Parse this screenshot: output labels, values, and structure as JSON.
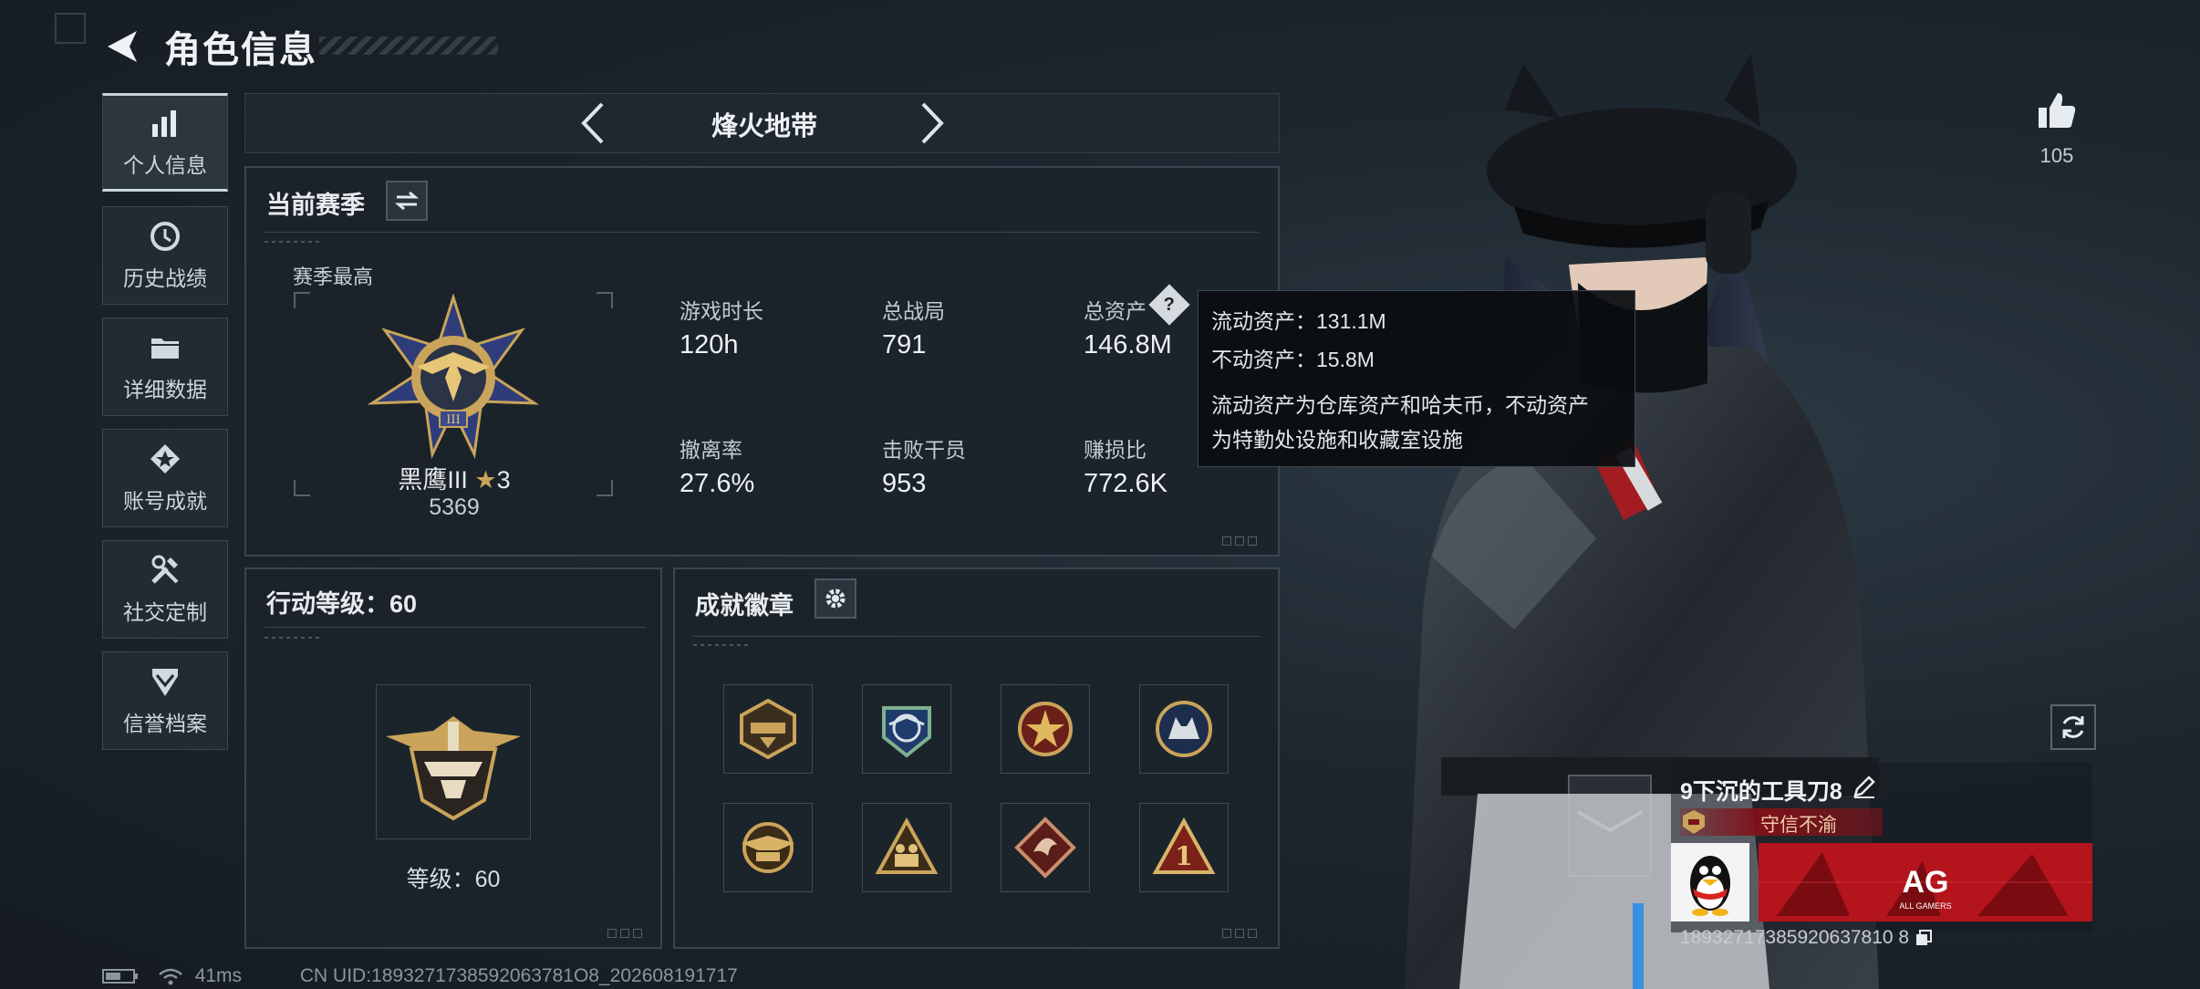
{
  "header": {
    "title": "角色信息"
  },
  "sidebar": {
    "items": [
      {
        "label": "个人信息",
        "icon": "bar-chart-icon",
        "active": true
      },
      {
        "label": "历史战绩",
        "icon": "history-clock-icon",
        "active": false
      },
      {
        "label": "详细数据",
        "icon": "folder-icon",
        "active": false
      },
      {
        "label": "账号成就",
        "icon": "achievement-medal-icon",
        "active": false
      },
      {
        "label": "社交定制",
        "icon": "tools-icon",
        "active": false
      },
      {
        "label": "信誉档案",
        "icon": "shield-chevron-icon",
        "active": false
      }
    ]
  },
  "mode": {
    "name": "烽火地带"
  },
  "season": {
    "title": "当前赛季",
    "best_label": "赛季最高",
    "rank_name": "黑鹰III",
    "rank_stars": "3",
    "rank_score": "5369",
    "stats": [
      {
        "label": "游戏时长",
        "value": "120h"
      },
      {
        "label": "总战局",
        "value": "791"
      },
      {
        "label": "总资产",
        "value": "146.8M"
      },
      {
        "label": "撤离率",
        "value": "27.6%"
      },
      {
        "label": "击败干员",
        "value": "953"
      },
      {
        "label": "赚损比",
        "value": "772.6K"
      }
    ]
  },
  "tooltip": {
    "liquid": "流动资产：131.1M",
    "fixed": "不动资产：15.8M",
    "desc_line1": "流动资产为仓库资产和哈夫币，不动资产",
    "desc_line2": "为特勤处设施和收藏室设施"
  },
  "level": {
    "title": "行动等级：60",
    "text": "等级：60"
  },
  "achievements": {
    "title": "成就徽章",
    "badges": [
      "emblem-badge-icon",
      "eagle-globe-badge-icon",
      "star-wreath-badge-icon",
      "wolf-round-badge-icon",
      "eagle-wing-badge-icon",
      "soldiers-triangle-badge-icon",
      "dragon-diamond-badge-icon",
      "number-one-triangle-badge-icon"
    ]
  },
  "status": {
    "ping": "41ms",
    "uid": "CN UID:1893271738592063781O8_202608191717"
  },
  "social": {
    "likes": "105"
  },
  "player": {
    "name": "9下沉的工具刀8",
    "title": "守信不渝",
    "uid": "18932717385920637810 8",
    "team_logo": "AG",
    "team_sub": "ALL GAMERS"
  },
  "colors": {
    "accent_red": "#b4141c",
    "gold": "#c9a45a",
    "panel": "#1b232a"
  }
}
